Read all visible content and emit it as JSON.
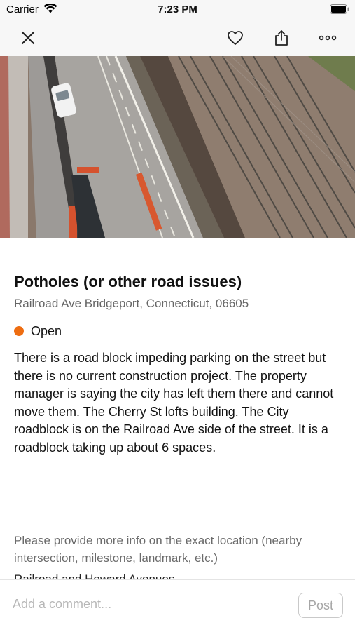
{
  "status_bar": {
    "carrier": "Carrier",
    "time": "7:23 PM"
  },
  "nav": {
    "icons": [
      "close-icon",
      "heart-icon",
      "share-icon",
      "more-icon"
    ]
  },
  "issue": {
    "title": "Potholes (or other road issues)",
    "address": "Railroad Ave Bridgeport, Connecticut, 06605",
    "status": "Open",
    "status_color": "#ee6d11",
    "description": "There is a road block impeding parking on the street but there is no current construction project. The property manager is saying the city has left them there and cannot move them. The Cherry St lofts building. The City roadblock is on the Railroad Ave side of the street. It is a roadblock taking up about 6 spaces.",
    "more_info_label": "Please provide more info on the exact location (nearby intersection, milestone, landmark, etc.)",
    "more_info_value": "Railroad and Howard Avenues"
  },
  "comment": {
    "placeholder": "Add a comment...",
    "post_label": "Post"
  }
}
